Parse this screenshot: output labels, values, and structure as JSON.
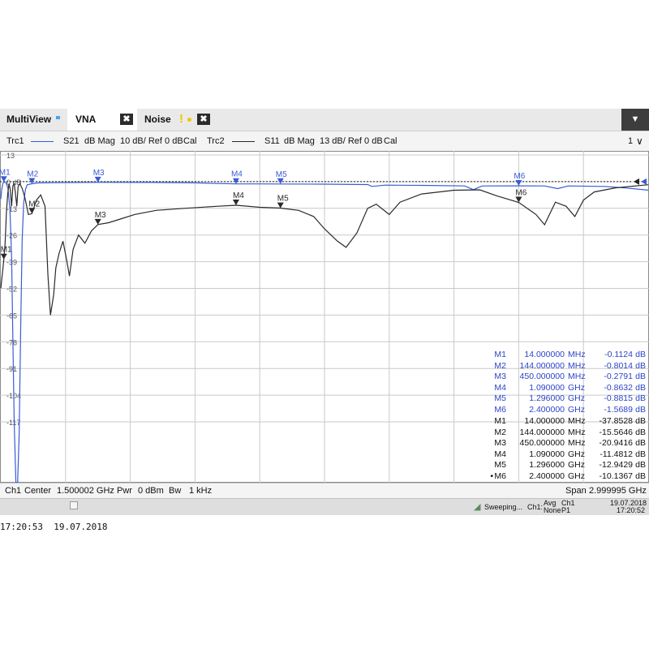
{
  "tabs": {
    "multiview": "MultiView",
    "vna": "VNA",
    "noise": "Noise",
    "close_glyph": "✖",
    "warning_glyph": "!",
    "menu_glyph": "▼"
  },
  "trace_header": {
    "trc1": "Trc1",
    "trc1_param": "S21",
    "trc1_format": "dB Mag",
    "trc1_scale": "10 dB/ Ref 0 dB",
    "trc1_cal": "Cal",
    "trc2": "Trc2",
    "trc2_param": "S11",
    "trc2_format": "dB Mag",
    "trc2_scale": "13 dB/ Ref 0 dB",
    "trc2_cal": "Cal",
    "window_number": "1",
    "window_chevron": "∨"
  },
  "colors": {
    "trc1": "#3a5bd6",
    "trc2": "#2a2a2a",
    "marker_table_trc1": "#2c44c8",
    "grid": "#c9c9c9"
  },
  "chart_data": {
    "type": "line",
    "x_unit": "GHz",
    "x_range": [
      5e-06,
      3.0
    ],
    "y_tick_labels": [
      "13",
      "0 dB",
      "-13",
      "-26",
      "-39",
      "-52",
      "-65",
      "-78",
      "-91",
      "-104",
      "-117"
    ],
    "grid": true,
    "series": [
      {
        "name": "Trc1",
        "param": "S21",
        "points": [
          [
            5e-06,
            -6.5
          ],
          [
            0.004,
            -3.0
          ],
          [
            0.009,
            -0.8
          ],
          [
            0.014,
            -0.11
          ],
          [
            0.024,
            -0.4
          ],
          [
            0.033,
            -2.5
          ],
          [
            0.042,
            -10
          ],
          [
            0.05,
            -28
          ],
          [
            0.056,
            -60
          ],
          [
            0.062,
            -90
          ],
          [
            0.07,
            -118
          ],
          [
            0.078,
            -118
          ],
          [
            0.085,
            -95
          ],
          [
            0.092,
            -55
          ],
          [
            0.099,
            -22
          ],
          [
            0.106,
            -8
          ],
          [
            0.114,
            -3.0
          ],
          [
            0.122,
            -1.2
          ],
          [
            0.144,
            -0.8
          ],
          [
            0.17,
            -0.5
          ],
          [
            0.25,
            -0.4
          ],
          [
            0.45,
            -0.28
          ],
          [
            0.7,
            -0.3
          ],
          [
            0.9,
            -0.45
          ],
          [
            1.09,
            -0.86
          ],
          [
            1.2,
            -0.85
          ],
          [
            1.296,
            -0.88
          ],
          [
            1.5,
            -0.95
          ],
          [
            1.7,
            -1.1
          ],
          [
            1.72,
            -1.8
          ],
          [
            1.78,
            -1.3
          ],
          [
            1.95,
            -1.4
          ],
          [
            2.15,
            -1.6
          ],
          [
            2.19,
            -3.0
          ],
          [
            2.23,
            -1.6
          ],
          [
            2.4,
            -1.57
          ],
          [
            2.52,
            -1.6
          ],
          [
            2.58,
            -2.6
          ],
          [
            2.63,
            -1.6
          ],
          [
            2.8,
            -1.8
          ],
          [
            2.9,
            -2.4
          ],
          [
            3.0,
            -3.2
          ]
        ]
      },
      {
        "name": "Trc2",
        "param": "S11",
        "points": [
          [
            5e-06,
            -52
          ],
          [
            0.006,
            -46
          ],
          [
            0.01,
            -42
          ],
          [
            0.014,
            -37.9
          ],
          [
            0.02,
            -30
          ],
          [
            0.026,
            -15
          ],
          [
            0.032,
            -6
          ],
          [
            0.038,
            -1.0
          ],
          [
            0.044,
            -4
          ],
          [
            0.05,
            -12
          ],
          [
            0.056,
            -2.0
          ],
          [
            0.062,
            -1.0
          ],
          [
            0.068,
            -6
          ],
          [
            0.074,
            -12
          ],
          [
            0.08,
            -2.5
          ],
          [
            0.088,
            -1.0
          ],
          [
            0.1,
            -3.5
          ],
          [
            0.112,
            -8
          ],
          [
            0.128,
            -16
          ],
          [
            0.144,
            -15.6
          ],
          [
            0.165,
            -9
          ],
          [
            0.185,
            -6.5
          ],
          [
            0.205,
            -12
          ],
          [
            0.218,
            -45
          ],
          [
            0.23,
            -65
          ],
          [
            0.245,
            -55
          ],
          [
            0.255,
            -42
          ],
          [
            0.27,
            -35
          ],
          [
            0.288,
            -29
          ],
          [
            0.305,
            -38
          ],
          [
            0.318,
            -46
          ],
          [
            0.335,
            -33
          ],
          [
            0.36,
            -26
          ],
          [
            0.39,
            -30
          ],
          [
            0.42,
            -24
          ],
          [
            0.45,
            -20.9
          ],
          [
            0.5,
            -20
          ],
          [
            0.56,
            -18
          ],
          [
            0.62,
            -16
          ],
          [
            0.72,
            -14
          ],
          [
            0.85,
            -13
          ],
          [
            1.0,
            -12
          ],
          [
            1.09,
            -11.5
          ],
          [
            1.2,
            -12.5
          ],
          [
            1.296,
            -12.9
          ],
          [
            1.38,
            -14
          ],
          [
            1.45,
            -17
          ],
          [
            1.5,
            -23
          ],
          [
            1.56,
            -29
          ],
          [
            1.6,
            -32
          ],
          [
            1.65,
            -25
          ],
          [
            1.7,
            -13
          ],
          [
            1.74,
            -11
          ],
          [
            1.8,
            -16
          ],
          [
            1.85,
            -10
          ],
          [
            1.95,
            -6
          ],
          [
            2.1,
            -4.2
          ],
          [
            2.22,
            -4
          ],
          [
            2.3,
            -7
          ],
          [
            2.4,
            -10.1
          ],
          [
            2.48,
            -16
          ],
          [
            2.52,
            -21
          ],
          [
            2.57,
            -10
          ],
          [
            2.62,
            -12
          ],
          [
            2.66,
            -17
          ],
          [
            2.7,
            -9
          ],
          [
            2.75,
            -5
          ],
          [
            2.85,
            -3
          ],
          [
            3.0,
            -1.5
          ]
        ]
      }
    ],
    "markers": [
      {
        "label": "M1",
        "x": 0.014
      },
      {
        "label": "M2",
        "x": 0.144
      },
      {
        "label": "M3",
        "x": 0.45
      },
      {
        "label": "M4",
        "x": 1.09
      },
      {
        "label": "M5",
        "x": 1.296
      },
      {
        "label": "M6",
        "x": 2.4
      }
    ],
    "reference_arrow_level": 0
  },
  "marker_table_trc1": [
    {
      "m": "M1",
      "val": "14.000000",
      "unit": "MHz",
      "db": "-0.1124",
      "u": "dB"
    },
    {
      "m": "M2",
      "val": "144.000000",
      "unit": "MHz",
      "db": "-0.8014",
      "u": "dB"
    },
    {
      "m": "M3",
      "val": "450.000000",
      "unit": "MHz",
      "db": "-0.2791",
      "u": "dB"
    },
    {
      "m": "M4",
      "val": "1.090000",
      "unit": "GHz",
      "db": "-0.8632",
      "u": "dB"
    },
    {
      "m": "M5",
      "val": "1.296000",
      "unit": "GHz",
      "db": "-0.8815",
      "u": "dB"
    },
    {
      "m": "M6",
      "val": "2.400000",
      "unit": "GHz",
      "db": "-1.5689",
      "u": "dB"
    }
  ],
  "marker_table_trc2": [
    {
      "m": "M1",
      "val": "14.000000",
      "unit": "MHz",
      "db": "-37.8528",
      "u": "dB"
    },
    {
      "m": "M2",
      "val": "144.000000",
      "unit": "MHz",
      "db": "-15.5646",
      "u": "dB"
    },
    {
      "m": "M3",
      "val": "450.000000",
      "unit": "MHz",
      "db": "-20.9416",
      "u": "dB"
    },
    {
      "m": "M4",
      "val": "1.090000",
      "unit": "GHz",
      "db": "-11.4812",
      "u": "dB"
    },
    {
      "m": "M5",
      "val": "1.296000",
      "unit": "GHz",
      "db": "-12.9429",
      "u": "dB"
    },
    {
      "m": "M6",
      "val": "2.400000",
      "unit": "GHz",
      "db": "-10.1367",
      "u": "dB",
      "active": "•"
    }
  ],
  "status": {
    "channel": "Ch1",
    "center_label": "Center",
    "center_value": "1.500002 GHz",
    "pwr_label": "Pwr",
    "pwr_value": "0 dBm",
    "bw_label": "Bw",
    "bw_value": "1 kHz",
    "span_label": "Span",
    "span_value": "2.999995 GHz"
  },
  "bottom": {
    "sweeping": "Sweeping...",
    "ch": "Ch1:",
    "avg": "Avg",
    "none": "None",
    "ch1": "Ch1",
    "p1": "P1",
    "date": "19.07.2018",
    "time": "17:20:52"
  },
  "timestamp": "17:20:53  19.07.2018"
}
